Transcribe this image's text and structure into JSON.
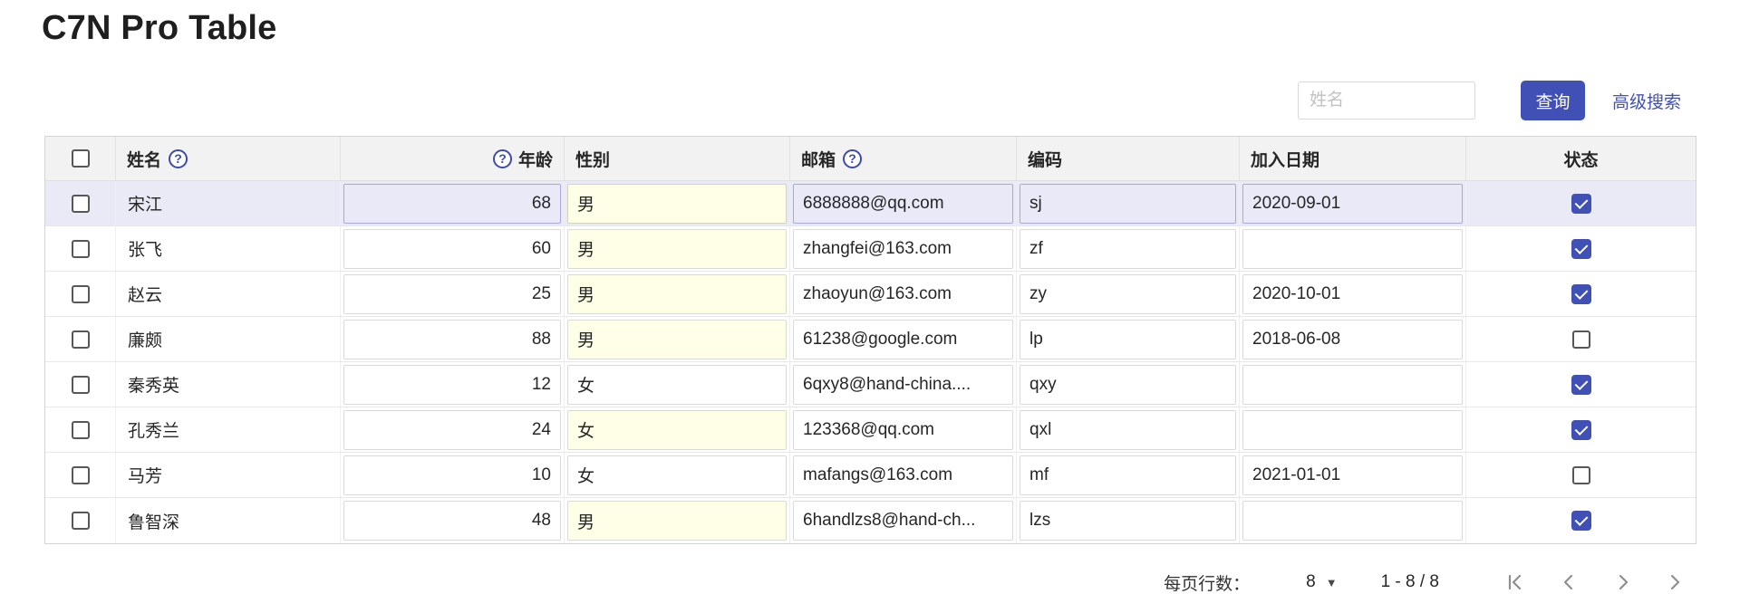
{
  "page": {
    "title": "C7N Pro Table"
  },
  "search": {
    "name_placeholder": "姓名",
    "query_button": "查询",
    "advanced_search": "高级搜索"
  },
  "icons": {
    "help_glyph": "?",
    "caret_down": "▼"
  },
  "colors": {
    "primary": "#4150b5",
    "header_bg": "#f2f2f2",
    "current_row_bg": "#eaeaf7",
    "required_cell_bg": "#feffe6",
    "checked_checkbox": "#4150b5"
  },
  "table": {
    "columns": [
      {
        "key": "select",
        "label": ""
      },
      {
        "key": "name",
        "label": "姓名",
        "help": true
      },
      {
        "key": "age",
        "label": "年龄",
        "help": true,
        "align": "right"
      },
      {
        "key": "sex",
        "label": "性别"
      },
      {
        "key": "email",
        "label": "邮箱",
        "help": true
      },
      {
        "key": "code",
        "label": "编码"
      },
      {
        "key": "joinDate",
        "label": "加入日期"
      },
      {
        "key": "enable",
        "label": "状态",
        "align": "center"
      }
    ],
    "rows": [
      {
        "name": "宋江",
        "age": "68",
        "sex": "男",
        "sex_required": true,
        "email": "6888888@qq.com",
        "code": "sj",
        "joinDate": "2020-09-01",
        "enable": true,
        "current": true,
        "selected": false
      },
      {
        "name": "张飞",
        "age": "60",
        "sex": "男",
        "sex_required": true,
        "email": "zhangfei@163.com",
        "code": "zf",
        "joinDate": "",
        "enable": true,
        "current": false,
        "selected": false
      },
      {
        "name": "赵云",
        "age": "25",
        "sex": "男",
        "sex_required": true,
        "email": "zhaoyun@163.com",
        "code": "zy",
        "joinDate": "2020-10-01",
        "enable": true,
        "current": false,
        "selected": false
      },
      {
        "name": "廉颇",
        "age": "88",
        "sex": "男",
        "sex_required": true,
        "email": "61238@google.com",
        "code": "lp",
        "joinDate": "2018-06-08",
        "enable": false,
        "current": false,
        "selected": false
      },
      {
        "name": "秦秀英",
        "age": "12",
        "sex": "女",
        "sex_required": false,
        "email": "6qxy8@hand-china....",
        "code": "qxy",
        "joinDate": "",
        "enable": true,
        "current": false,
        "selected": false
      },
      {
        "name": "孔秀兰",
        "age": "24",
        "sex": "女",
        "sex_required": true,
        "email": "123368@qq.com",
        "code": "qxl",
        "joinDate": "",
        "enable": true,
        "current": false,
        "selected": false
      },
      {
        "name": "马芳",
        "age": "10",
        "sex": "女",
        "sex_required": false,
        "email": "mafangs@163.com",
        "code": "mf",
        "joinDate": "2021-01-01",
        "enable": false,
        "current": false,
        "selected": false
      },
      {
        "name": "鲁智深",
        "age": "48",
        "sex": "男",
        "sex_required": true,
        "email": "6handlzs8@hand-ch...",
        "code": "lzs",
        "joinDate": "",
        "enable": true,
        "current": false,
        "selected": false
      }
    ]
  },
  "pagination": {
    "rows_per_page_label": "每页行数：",
    "page_size": "8",
    "range": "1 - 8 / 8"
  }
}
